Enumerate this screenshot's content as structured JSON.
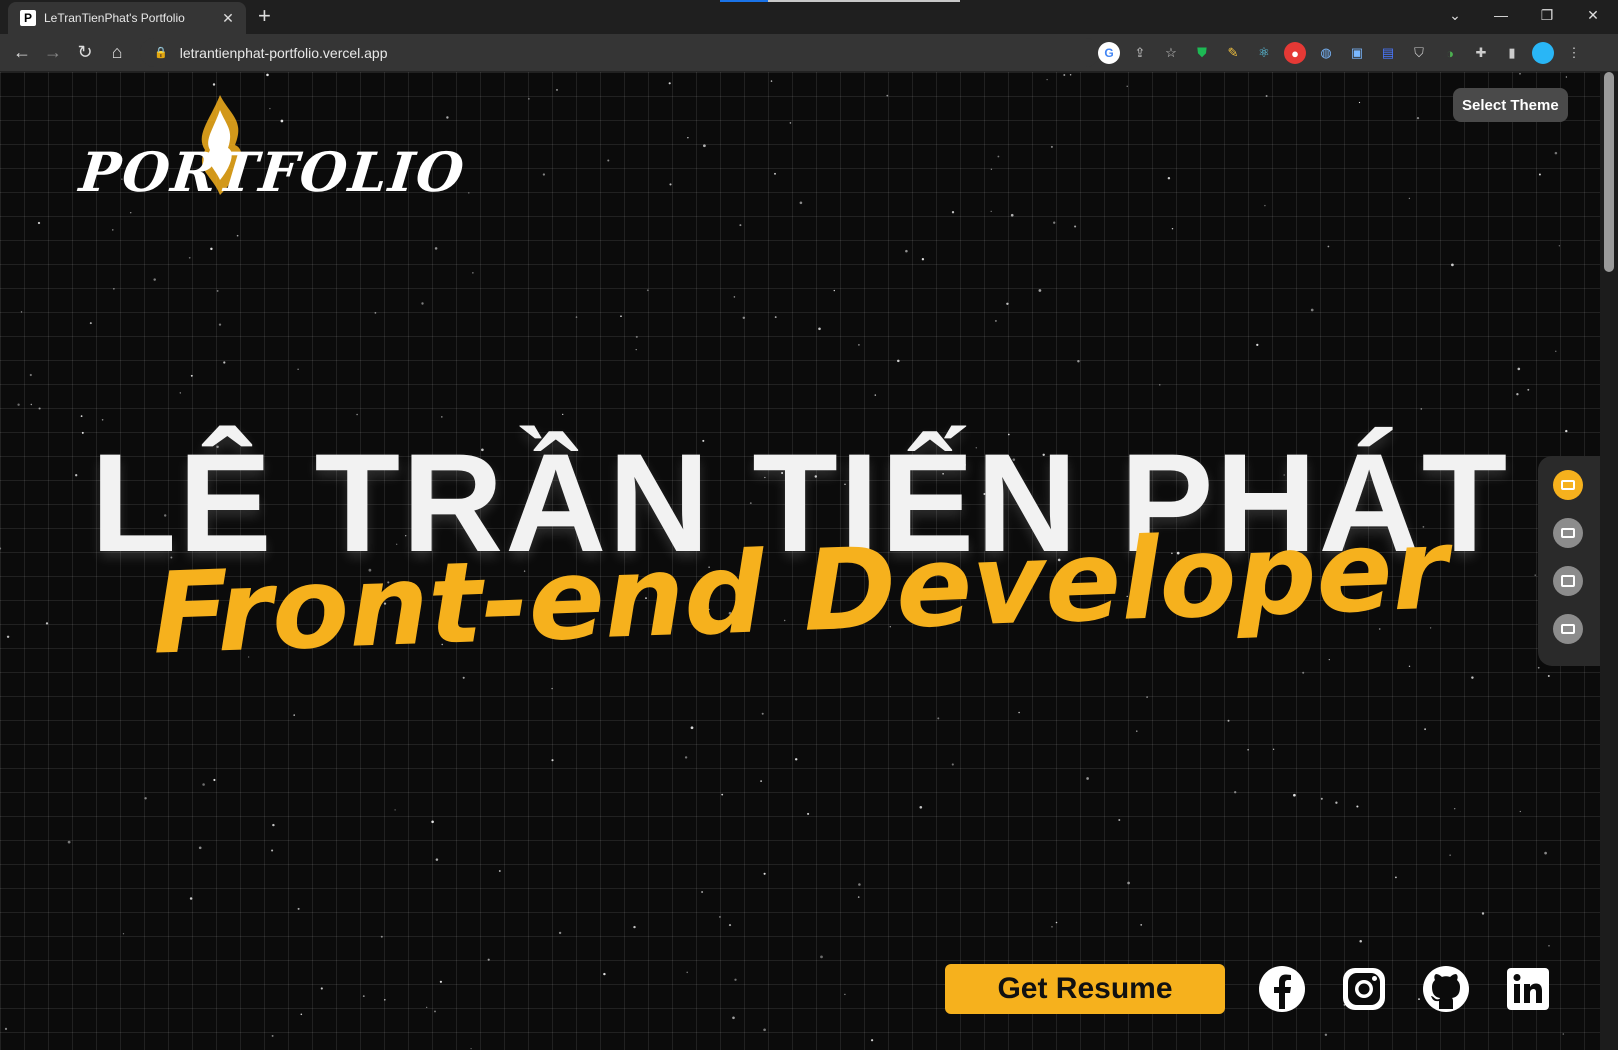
{
  "browser": {
    "tab_title": "LeTranTienPhat's Portfolio",
    "tab_favicon": "P",
    "url": "letrantienphat-portfolio.vercel.app"
  },
  "page": {
    "logo_text": "PORTFOLIO",
    "select_theme_label": "Select Theme",
    "hero_name": "LÊ TRẦN TIẾN PHÁT",
    "hero_role": "Front-end Developer",
    "resume_button_label": "Get Resume",
    "accent_color": "#f6b11d",
    "side_nav": [
      "home-icon",
      "list-icon",
      "briefcase-icon",
      "contact-card-icon"
    ],
    "social_links": [
      "facebook-icon",
      "instagram-icon",
      "github-icon",
      "linkedin-icon"
    ]
  }
}
